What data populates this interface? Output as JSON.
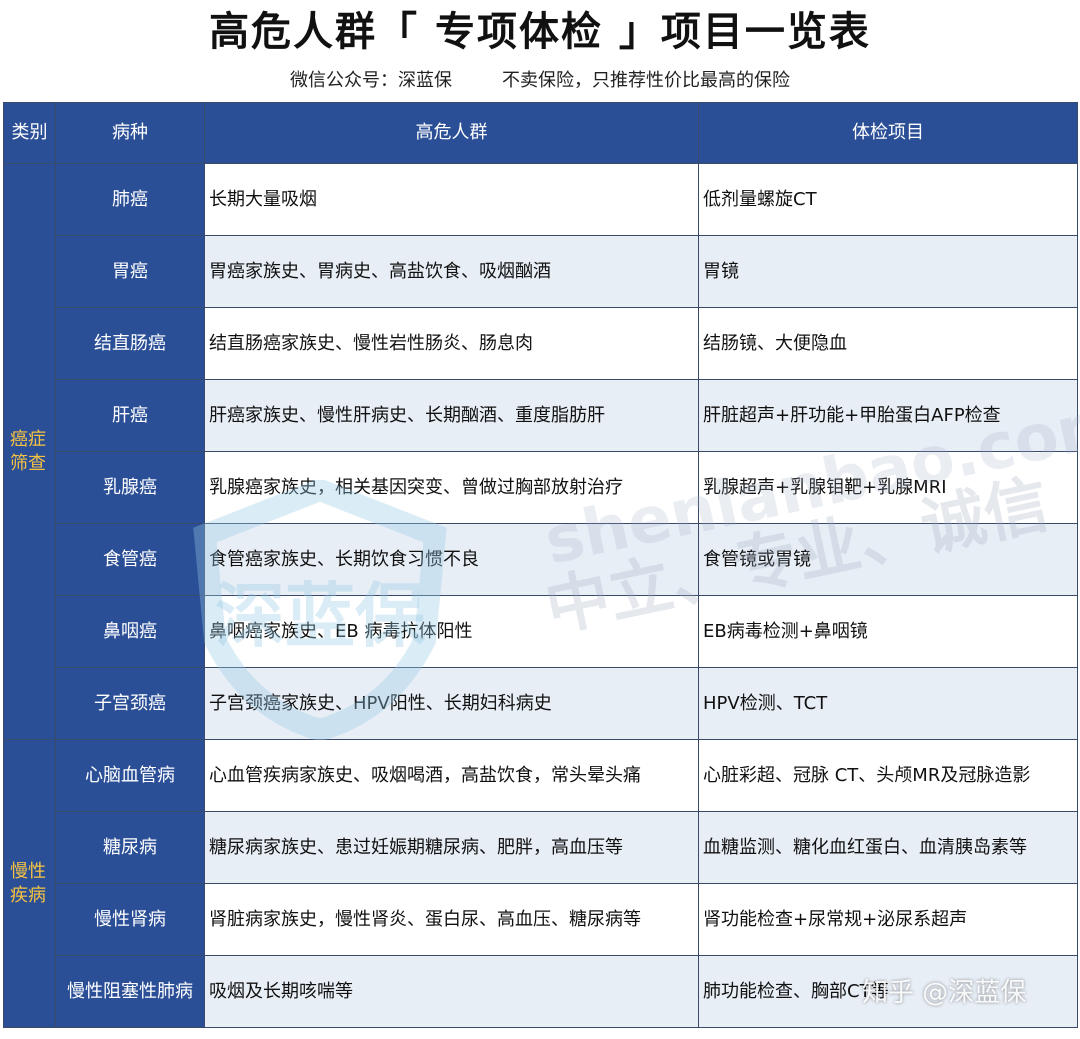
{
  "title": "高危人群「 专项体检 」项目一览表",
  "subtitle": {
    "account": "微信公众号：深蓝保",
    "slogan": "不卖保险，只推荐性价比最高的保险"
  },
  "headers": {
    "category": "类别",
    "disease": "病种",
    "high_risk": "高危人群",
    "exams": "体检项目"
  },
  "groups": [
    {
      "category": "癌症筛查",
      "rows": [
        {
          "disease": "肺癌",
          "high_risk": "长期大量吸烟",
          "exams": "低剂量螺旋CT"
        },
        {
          "disease": "胃癌",
          "high_risk": "胃癌家族史、胃病史、高盐饮食、吸烟酗酒",
          "exams": "胃镜"
        },
        {
          "disease": "结直肠癌",
          "high_risk": "结直肠癌家族史、慢性岩性肠炎、肠息肉",
          "exams": "结肠镜、大便隐血"
        },
        {
          "disease": "肝癌",
          "high_risk": "肝癌家族史、慢性肝病史、长期酗酒、重度脂肪肝",
          "exams": "肝脏超声+肝功能+甲胎蛋白AFP检查"
        },
        {
          "disease": "乳腺癌",
          "high_risk": "乳腺癌家族史，相关基因突变、曾做过胸部放射治疗",
          "exams": "乳腺超声+乳腺钼靶+乳腺MRI"
        },
        {
          "disease": "食管癌",
          "high_risk": "食管癌家族史、长期饮食习惯不良",
          "exams": "食管镜或胃镜"
        },
        {
          "disease": "鼻咽癌",
          "high_risk": "鼻咽癌家族史、EB 病毒抗体阳性",
          "exams": "EB病毒检测+鼻咽镜"
        },
        {
          "disease": "子宫颈癌",
          "high_risk": "子宫颈癌家族史、HPV阳性、长期妇科病史",
          "exams": "HPV检测、TCT"
        }
      ]
    },
    {
      "category": "慢性疾病",
      "rows": [
        {
          "disease": "心脑血管病",
          "high_risk": "心血管疾病家族史、吸烟喝酒，高盐饮食，常头晕头痛",
          "exams": "心脏彩超、冠脉 CT、头颅MR及冠脉造影"
        },
        {
          "disease": "糖尿病",
          "high_risk": "糖尿病家族史、患过妊娠期糖尿病、肥胖，高血压等",
          "exams": "血糖监测、糖化血红蛋白、血清胰岛素等"
        },
        {
          "disease": "慢性肾病",
          "high_risk": "肾脏病家族史，慢性肾炎、蛋白尿、高血压、糖尿病等",
          "exams": "肾功能检查+尿常规+泌尿系超声"
        },
        {
          "disease": "慢性阻塞性肺病",
          "high_risk": "吸烟及长期咳喘等",
          "exams": "肺功能检查、胸部CT等"
        }
      ]
    }
  ],
  "watermark": {
    "site": "shenlanbao.com",
    "slogan": "中立、专业、诚信",
    "logo_text": "深蓝保"
  },
  "credit": "知乎 @深蓝保",
  "colors": {
    "header_bg": "#2b4f96",
    "category_text": "#f5c242",
    "row_alt_bg": "#e8eef6"
  }
}
